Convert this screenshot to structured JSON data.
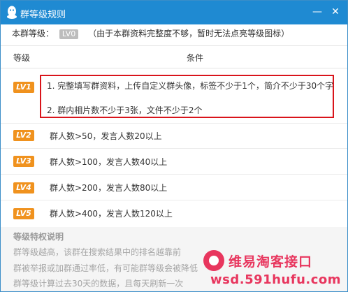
{
  "window": {
    "title": "群等级规则",
    "minimize_label": "—",
    "close_label": "✕"
  },
  "current_rank": {
    "label": "本群等级：",
    "badge": "LV0",
    "note": "（由于本群资料完整度不够，暂时无法点亮等级图标）"
  },
  "table": {
    "header_level": "等级",
    "header_condition": "条件",
    "rows": [
      {
        "badge": "LV1",
        "conditions": [
          "1. 完整填写群资料，上传自定义群头像，标签不少于1个，简介不少于30个字",
          "2. 群内相片数不少于3张，文件不少于2个"
        ]
      },
      {
        "badge": "LV2",
        "conditions": [
          "群人数>50，发言人数20以上"
        ]
      },
      {
        "badge": "LV3",
        "conditions": [
          "群人数>100，发言人数40以上"
        ]
      },
      {
        "badge": "LV4",
        "conditions": [
          "群人数>200，发言人数80以上"
        ]
      },
      {
        "badge": "LV5",
        "conditions": [
          "群人数>400，发言人数120以上"
        ]
      }
    ]
  },
  "privileges": {
    "title": "等级特权说明",
    "lines": [
      "群等级越高，该群在搜索结果中的排名越靠前",
      "群被举报或加群通过率低，有可能群等级会被降低",
      "群等级计算过去30天的数据，且每天刷新一次"
    ]
  },
  "watermark": {
    "line1": "维易淘客接口",
    "line2": "wsd.591hufu.com"
  },
  "colors": {
    "titlebar": "#1f8ad2",
    "level_badge": "#f0921e",
    "highlight_box": "#d9141b",
    "watermark": "#e8365e"
  }
}
